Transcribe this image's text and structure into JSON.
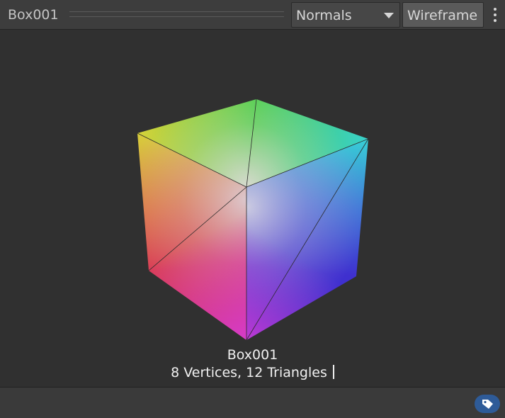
{
  "header": {
    "title": "Box001",
    "shading_dropdown": {
      "selected": "Normals"
    },
    "wireframe_toggle": {
      "label": "Wireframe",
      "state": "on"
    },
    "menu_icon": "vertical-ellipsis-icon"
  },
  "viewport": {
    "object_name": "Box001",
    "stats": "8 Vertices, 12 Triangles",
    "cube_colors": {
      "top_left": "#d8d23a",
      "top_back": "#47cf3a",
      "top_right": "#38d0cc",
      "mid_left": "#e06a42",
      "center_top": "#dcd4dc",
      "right_lower": "#3f30cf",
      "bottom_left": "#d93c55",
      "bottom": "#d53bd1"
    }
  },
  "footer": {
    "tag_icon": "tag-icon",
    "tag_color": "#2e5b98"
  }
}
